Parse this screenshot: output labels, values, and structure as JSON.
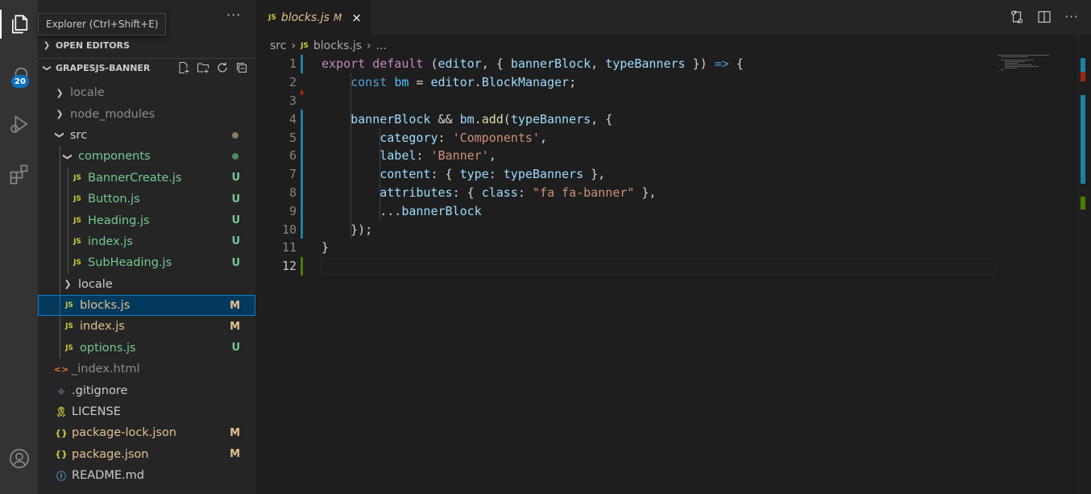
{
  "tooltip": "Explorer (Ctrl+Shift+E)",
  "activity": {
    "source_control_badge": "20"
  },
  "sidebar": {
    "more": "···",
    "open_editors": "OPEN EDITORS",
    "project": "GRAPESJS-BANNER",
    "tree": [
      {
        "label": "locale",
        "kind": "folder",
        "expanded": false,
        "depth": 1,
        "color": "dim"
      },
      {
        "label": "node_modules",
        "kind": "folder",
        "expanded": false,
        "depth": 1,
        "color": "dim"
      },
      {
        "label": "src",
        "kind": "folder",
        "expanded": true,
        "depth": 1,
        "dot": "#8c7a5c"
      },
      {
        "label": "components",
        "kind": "folder",
        "expanded": true,
        "depth": 2,
        "color": "green",
        "dot": "#4e8a5e"
      },
      {
        "label": "BannerCreate.js",
        "kind": "js",
        "depth": 3,
        "color": "green",
        "status": "U"
      },
      {
        "label": "Button.js",
        "kind": "js",
        "depth": 3,
        "color": "green",
        "status": "U"
      },
      {
        "label": "Heading.js",
        "kind": "js",
        "depth": 3,
        "color": "green",
        "status": "U"
      },
      {
        "label": "index.js",
        "kind": "js",
        "depth": 3,
        "color": "green",
        "status": "U"
      },
      {
        "label": "SubHeading.js",
        "kind": "js",
        "depth": 3,
        "color": "green",
        "status": "U"
      },
      {
        "label": "locale",
        "kind": "folder",
        "expanded": false,
        "depth": 2
      },
      {
        "label": "blocks.js",
        "kind": "js",
        "depth": 2,
        "color": "mod",
        "status": "M",
        "selected": true
      },
      {
        "label": "index.js",
        "kind": "js",
        "depth": 2,
        "color": "mod",
        "status": "M"
      },
      {
        "label": "options.js",
        "kind": "js",
        "depth": 2,
        "color": "green",
        "status": "U"
      },
      {
        "label": "_index.html",
        "kind": "html",
        "depth": 1,
        "color": "dim"
      },
      {
        "label": ".gitignore",
        "kind": "git",
        "depth": 1
      },
      {
        "label": "LICENSE",
        "kind": "license",
        "depth": 1
      },
      {
        "label": "package-lock.json",
        "kind": "json",
        "depth": 1,
        "color": "mod",
        "status": "M"
      },
      {
        "label": "package.json",
        "kind": "json",
        "depth": 1,
        "color": "mod",
        "status": "M"
      },
      {
        "label": "README.md",
        "kind": "info",
        "depth": 1
      }
    ]
  },
  "editor": {
    "tab": {
      "icon": "JS",
      "name": "blocks.js",
      "modified": "M",
      "close": "×"
    },
    "breadcrumb": {
      "folder": "src",
      "icon": "JS",
      "file": "blocks.js",
      "more": "..."
    },
    "lines": [
      {
        "n": "1",
        "tokens": [
          [
            "cf",
            "export"
          ],
          [
            "p",
            " "
          ],
          [
            "cf",
            "default"
          ],
          [
            "p",
            " ("
          ],
          [
            "v",
            "editor"
          ],
          [
            "p",
            ", { "
          ],
          [
            "v",
            "bannerBlock"
          ],
          [
            "p",
            ", "
          ],
          [
            "v",
            "typeBanners"
          ],
          [
            "p",
            " }) "
          ],
          [
            "k",
            "=>"
          ],
          [
            "p",
            " {"
          ]
        ]
      },
      {
        "n": "2",
        "tokens": [
          [
            "p",
            "    "
          ],
          [
            "k",
            "const"
          ],
          [
            "p",
            " "
          ],
          [
            "c",
            "bm"
          ],
          [
            "p",
            " = "
          ],
          [
            "v",
            "editor"
          ],
          [
            "p",
            "."
          ],
          [
            "v",
            "BlockManager"
          ],
          [
            "p",
            ";"
          ]
        ]
      },
      {
        "n": "3",
        "tokens": []
      },
      {
        "n": "4",
        "tokens": [
          [
            "p",
            "    "
          ],
          [
            "v",
            "bannerBlock"
          ],
          [
            "p",
            " && "
          ],
          [
            "v",
            "bm"
          ],
          [
            "p",
            "."
          ],
          [
            "fn",
            "add"
          ],
          [
            "p",
            "("
          ],
          [
            "v",
            "typeBanners"
          ],
          [
            "p",
            ", {"
          ]
        ]
      },
      {
        "n": "5",
        "tokens": [
          [
            "p",
            "        "
          ],
          [
            "v",
            "category"
          ],
          [
            "p",
            ": "
          ],
          [
            "s",
            "'Components'"
          ],
          [
            "p",
            ","
          ]
        ]
      },
      {
        "n": "6",
        "tokens": [
          [
            "p",
            "        "
          ],
          [
            "v",
            "label"
          ],
          [
            "p",
            ": "
          ],
          [
            "s",
            "'Banner'"
          ],
          [
            "p",
            ","
          ]
        ]
      },
      {
        "n": "7",
        "tokens": [
          [
            "p",
            "        "
          ],
          [
            "v",
            "content"
          ],
          [
            "p",
            ": { "
          ],
          [
            "v",
            "type"
          ],
          [
            "p",
            ": "
          ],
          [
            "v",
            "typeBanners"
          ],
          [
            "p",
            " },"
          ]
        ]
      },
      {
        "n": "8",
        "tokens": [
          [
            "p",
            "        "
          ],
          [
            "v",
            "attributes"
          ],
          [
            "p",
            ": { "
          ],
          [
            "v",
            "class"
          ],
          [
            "p",
            ": "
          ],
          [
            "s",
            "\"fa fa-banner\""
          ],
          [
            "p",
            " },"
          ]
        ]
      },
      {
        "n": "9",
        "tokens": [
          [
            "p",
            "        ..."
          ],
          [
            "v",
            "bannerBlock"
          ]
        ]
      },
      {
        "n": "10",
        "tokens": [
          [
            "p",
            "    });"
          ]
        ]
      },
      {
        "n": "11",
        "tokens": [
          [
            "p",
            "}"
          ]
        ]
      },
      {
        "n": "12",
        "tokens": []
      }
    ]
  },
  "colors": {
    "accent": "#007acc",
    "modified_gutter": "#1b81a8",
    "added_gutter": "#487e02",
    "deleted_marker": "#a1260d"
  }
}
